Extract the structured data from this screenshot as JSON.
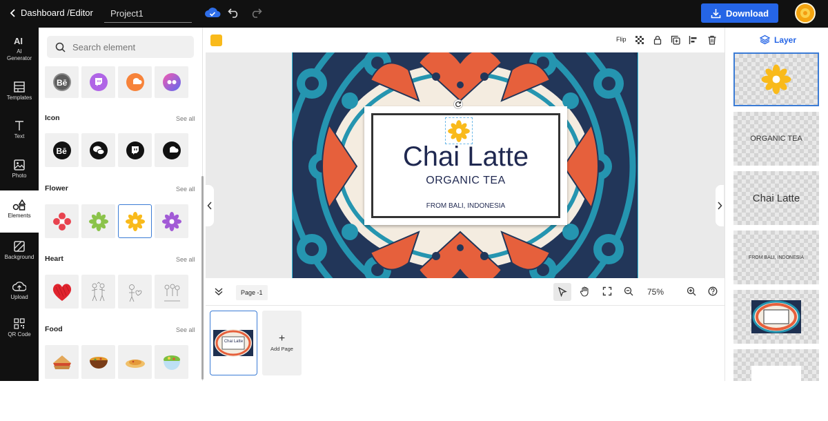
{
  "topbar": {
    "breadcrumb": "Dashboard /Editor",
    "project_name": "Project1",
    "download_label": "Download"
  },
  "leftnav": [
    {
      "label": "AI Generator",
      "icon": "ai-icon"
    },
    {
      "label": "Templates",
      "icon": "templates-icon"
    },
    {
      "label": "Text",
      "icon": "text-icon"
    },
    {
      "label": "Photo",
      "icon": "photo-icon"
    },
    {
      "label": "Elements",
      "icon": "elements-icon",
      "active": true
    },
    {
      "label": "Background",
      "icon": "background-icon"
    },
    {
      "label": "Upload",
      "icon": "upload-icon"
    },
    {
      "label": "QR Code",
      "icon": "qr-code-icon"
    }
  ],
  "panel": {
    "search_placeholder": "Search element",
    "sections": [
      {
        "title": "Icon",
        "see_all": "See all"
      },
      {
        "title": "Flower",
        "see_all": "See all"
      },
      {
        "title": "Heart",
        "see_all": "See all"
      },
      {
        "title": "Food",
        "see_all": "See all"
      }
    ]
  },
  "toolbar": {
    "flip_label": "Flip",
    "accent_color": "#f9ba1b"
  },
  "design": {
    "title": "Chai Latte",
    "subtitle": "ORGANIC TEA",
    "origin": "FROM BALI, INDONESIA"
  },
  "bottombar": {
    "page_label": "Page -1",
    "zoom": "75%"
  },
  "pages": {
    "add_page_label": "Add Page",
    "thumb_title": "Chai Latte"
  },
  "layers": {
    "heading": "Layer",
    "items": [
      "ORGANIC TEA",
      "Chai Latte",
      "FROM BALI, INDONESIA"
    ]
  },
  "colors": {
    "brand_blue": "#2565e6",
    "navy": "#1f2850",
    "orange": "#e6603c",
    "teal": "#2595b0"
  }
}
